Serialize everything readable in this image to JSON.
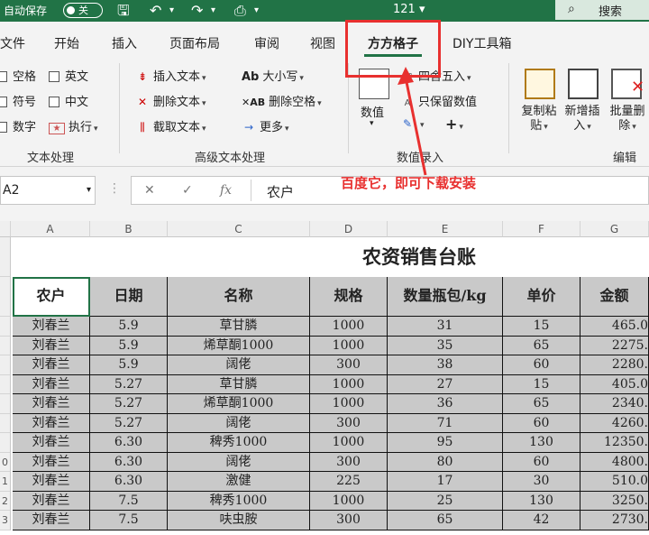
{
  "titlebar": {
    "autosave_label": "自动保存",
    "autosave_state": "关",
    "doc_title": "121 ▾",
    "search_label": "搜索"
  },
  "tabs": [
    "文件",
    "开始",
    "插入",
    "页面布局",
    "审阅",
    "视图",
    "方方格子",
    "DIY工具箱"
  ],
  "active_tab": "方方格子",
  "ribbon": {
    "text_group": {
      "items": [
        "空格",
        "英文",
        "符号",
        "中文",
        "数字"
      ],
      "execute_label": "执行",
      "label": "文本处理"
    },
    "advanced_group": {
      "items": [
        "插入文本",
        "大小写",
        "删除文本",
        "删除空格",
        "截取文本",
        "更多"
      ],
      "label": "高级文本处理"
    },
    "numeric_group": {
      "value_label": "数值",
      "round_label": "四舍五入",
      "keep_value_label": "只保留数值",
      "plus_label": "+",
      "label": "数值录入"
    },
    "edit_group": {
      "buttons": [
        "复制粘贴",
        "新增插入",
        "批量删除"
      ],
      "label": "编辑"
    }
  },
  "formula_bar": {
    "name_box": "A2",
    "fx_symbol": "fx",
    "cancel_symbol": "✕",
    "confirm_symbol": "✓",
    "value": "农户"
  },
  "annotation": "百度它，即可下载安装",
  "columns": [
    "A",
    "B",
    "C",
    "D",
    "E",
    "F",
    "G"
  ],
  "row_numbers": [
    "",
    "",
    "",
    "",
    "",
    "",
    "",
    "",
    "",
    "0",
    "1",
    "2",
    "3"
  ],
  "sheet": {
    "title": "农资销售台账",
    "headers": [
      "农户",
      "日期",
      "名称",
      "规格",
      "数量瓶包/kg",
      "单价",
      "金额"
    ],
    "rows": [
      [
        "刘春兰",
        "5.9",
        "草甘膦",
        "1000",
        "31",
        "15",
        "465.0"
      ],
      [
        "刘春兰",
        "5.9",
        "烯草酮1000",
        "1000",
        "35",
        "65",
        "2275."
      ],
      [
        "刘春兰",
        "5.9",
        "阔佬",
        "300",
        "38",
        "60",
        "2280."
      ],
      [
        "刘春兰",
        "5.27",
        "草甘膦",
        "1000",
        "27",
        "15",
        "405.0"
      ],
      [
        "刘春兰",
        "5.27",
        "烯草酮1000",
        "1000",
        "36",
        "65",
        "2340."
      ],
      [
        "刘春兰",
        "5.27",
        "阔佬",
        "300",
        "71",
        "60",
        "4260."
      ],
      [
        "刘春兰",
        "6.30",
        "稗秀1000",
        "1000",
        "95",
        "130",
        "12350."
      ],
      [
        "刘春兰",
        "6.30",
        "阔佬",
        "300",
        "80",
        "60",
        "4800."
      ],
      [
        "刘春兰",
        "6.30",
        "激健",
        "225",
        "17",
        "30",
        "510.0"
      ],
      [
        "刘春兰",
        "7.5",
        "稗秀1000",
        "1000",
        "25",
        "130",
        "3250."
      ],
      [
        "刘春兰",
        "7.5",
        "呋虫胺",
        "300",
        "65",
        "42",
        "2730."
      ]
    ]
  }
}
